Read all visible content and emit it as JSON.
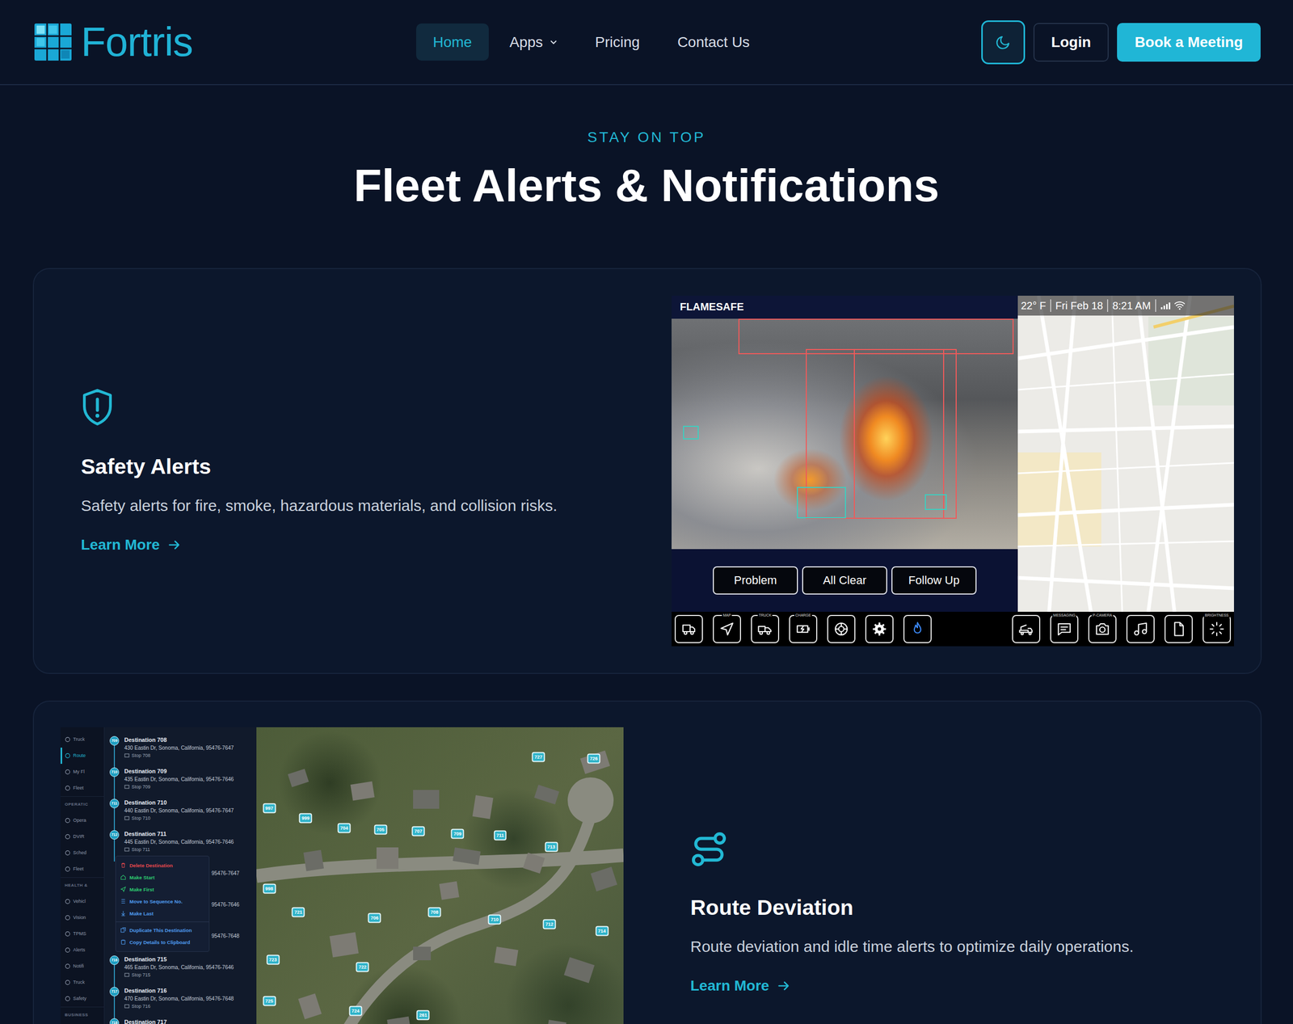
{
  "nav": {
    "logo": "Fortris",
    "links": [
      {
        "label": "Home",
        "selected": true,
        "dropdown": false
      },
      {
        "label": "Apps",
        "selected": false,
        "dropdown": true
      },
      {
        "label": "Pricing",
        "selected": false,
        "dropdown": false
      },
      {
        "label": "Contact Us",
        "selected": false,
        "dropdown": false
      }
    ],
    "login": "Login",
    "cta": "Book a Meeting"
  },
  "hero": {
    "eyebrow": "STAY ON TOP",
    "title": "Fleet Alerts & Notifications"
  },
  "features": [
    {
      "kind": "safety",
      "title": "Safety Alerts",
      "description": "Safety alerts for fire, smoke, hazardous materials, and collision risks.",
      "link": "Learn More",
      "screen": {
        "app_name": "FLAMESAFE",
        "status": [
          "22° F",
          "Fri Feb 18",
          "8:21 AM"
        ],
        "actions": [
          "Problem",
          "All Clear",
          "Follow Up"
        ],
        "toolbar_left": [
          {
            "selected": false
          },
          {
            "label": "MAP",
            "selected": false
          },
          {
            "label": "TRUCK",
            "selected": false
          },
          {
            "label": "CHARGE",
            "selected": false
          },
          {
            "selected": false
          },
          {
            "selected": false
          },
          {
            "selected": true
          }
        ],
        "toolbar_right": [
          {
            "selected": false
          },
          {
            "label": "MESSAGING",
            "selected": false
          },
          {
            "label": "P-CAMERA",
            "selected": false
          },
          {
            "selected": false
          },
          {
            "selected": false
          },
          {
            "label": "BRIGHTNESS",
            "selected": false
          }
        ]
      }
    },
    {
      "kind": "route",
      "title": "Route Deviation",
      "description": "Route deviation and idle time alerts to optimize daily operations.",
      "link": "Learn More",
      "screen": {
        "sidebar": [
          {
            "kind": "item",
            "label": "Truck",
            "selected": false
          },
          {
            "kind": "item",
            "label": "Route",
            "selected": true
          },
          {
            "kind": "item",
            "label": "My Fl",
            "selected": false
          },
          {
            "kind": "item",
            "label": "Fleet",
            "selected": false
          },
          {
            "kind": "section",
            "label": "OPERATIC",
            "selected": false
          },
          {
            "kind": "item",
            "label": "Opera",
            "selected": false
          },
          {
            "kind": "item",
            "label": "DVIR",
            "selected": false
          },
          {
            "kind": "item",
            "label": "Sched",
            "selected": false
          },
          {
            "kind": "item",
            "label": "Fleet",
            "selected": false
          },
          {
            "kind": "section",
            "label": "HEALTH &",
            "selected": false
          },
          {
            "kind": "item",
            "label": "Vehicl",
            "selected": false
          },
          {
            "kind": "item",
            "label": "Vision",
            "selected": false
          },
          {
            "kind": "item",
            "label": "TPMS",
            "selected": false
          },
          {
            "kind": "item",
            "label": "Alerts",
            "selected": false
          },
          {
            "kind": "item",
            "label": "Notifi",
            "selected": false
          },
          {
            "kind": "item",
            "label": "Truck",
            "selected": false
          },
          {
            "kind": "item",
            "label": "Safety",
            "selected": false
          },
          {
            "kind": "section",
            "label": "BUSINESS",
            "selected": false
          }
        ],
        "destinations": [
          {
            "kind": "row",
            "badge": "709",
            "title": "Destination 708",
            "address": "430 Eastin Dr, Sonoma, California, 95476-7647",
            "stop": "Stop 708"
          },
          {
            "kind": "row",
            "badge": "710",
            "title": "Destination 709",
            "address": "435 Eastin Dr, Sonoma, California, 95476-7646",
            "stop": "Stop 709"
          },
          {
            "kind": "row",
            "badge": "711",
            "title": "Destination 710",
            "address": "440 Eastin Dr, Sonoma, California, 95476-7647",
            "stop": "Stop 710"
          },
          {
            "kind": "row",
            "badge": "712",
            "title": "Destination 711",
            "address": "445 Eastin Dr, Sonoma, California, 95476-7646",
            "stop": "Stop 711"
          },
          {
            "kind": "covered",
            "tail": "95476-7647"
          },
          {
            "kind": "covered",
            "tail": "95476-7646"
          },
          {
            "kind": "covered",
            "tail": "95476-7648"
          },
          {
            "kind": "row",
            "badge": "716",
            "title": "Destination 715",
            "address": "465 Eastin Dr, Sonoma, California, 95476-7646",
            "stop": "Stop 715"
          },
          {
            "kind": "row",
            "badge": "717",
            "title": "Destination 716",
            "address": "470 Eastin Dr, Sonoma, California, 95476-7648",
            "stop": "Stop 716"
          },
          {
            "kind": "row",
            "badge": "718",
            "title": "Destination 717"
          }
        ],
        "context_menu": [
          {
            "label": "Delete Destination",
            "color": "#e5484d"
          },
          {
            "label": "Make Start",
            "color": "#2ecc71"
          },
          {
            "label": "Make First",
            "color": "#2ecc71"
          },
          {
            "label": "Move to Sequence No.",
            "color": "#4f9cf0"
          },
          {
            "label": "Make Last",
            "color": "#4f9cf0"
          },
          {
            "label": "Duplicate This Destination",
            "color": "#4f9cf0"
          },
          {
            "label": "Copy Details to Clipboard",
            "color": "#4f9cf0"
          }
        ],
        "pins": [
          {
            "label": "727"
          },
          {
            "label": "726"
          },
          {
            "label": "997"
          },
          {
            "label": "999"
          },
          {
            "label": "704"
          },
          {
            "label": "705"
          },
          {
            "label": "707"
          },
          {
            "label": "709"
          },
          {
            "label": "711"
          },
          {
            "label": "713"
          },
          {
            "label": "998"
          },
          {
            "label": "721"
          },
          {
            "label": "706"
          },
          {
            "label": "708"
          },
          {
            "label": "710"
          },
          {
            "label": "712"
          },
          {
            "label": "714"
          },
          {
            "label": "723"
          },
          {
            "label": "722"
          },
          {
            "label": "725"
          },
          {
            "label": "724"
          },
          {
            "label": "261"
          }
        ]
      }
    }
  ]
}
